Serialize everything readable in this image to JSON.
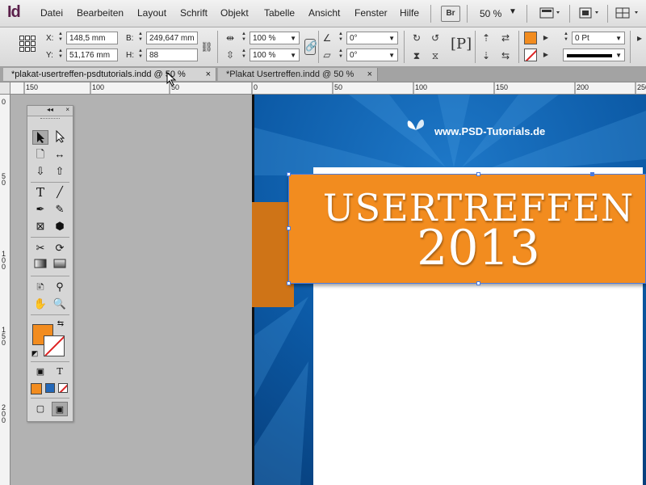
{
  "app": {
    "logo": "Id"
  },
  "menu": [
    "Datei",
    "Bearbeiten",
    "Layout",
    "Schrift",
    "Objekt",
    "Tabelle",
    "Ansicht",
    "Fenster",
    "Hilfe"
  ],
  "menubar": {
    "bridge_label": "Br",
    "zoom": "50 %"
  },
  "control": {
    "x_label": "X:",
    "x_value": "148,5 mm",
    "y_label": "Y:",
    "y_value": "51,176 mm",
    "w_label": "B:",
    "w_value": "249,647 mm",
    "h_label": "H:",
    "h_value": "88",
    "scale_x": "100 %",
    "scale_y": "100 %",
    "rotate": "0°",
    "shear": "0°",
    "stroke_weight": "0 Pt",
    "fill_color": "#f28c1f"
  },
  "tabs": [
    {
      "label": "*plakat-usertreffen-psdtutorials.indd @ 50 %",
      "close": "×"
    },
    {
      "label": "*Plakat Usertreffen.indd @ 50 %",
      "close": "×"
    }
  ],
  "ruler": {
    "h": [
      "150",
      "100",
      "50",
      "0",
      "50",
      "100",
      "150",
      "200",
      "250"
    ],
    "v": [
      "0",
      "5 0",
      "1 0 0",
      "1 5 0",
      "2 0 0"
    ]
  },
  "poster": {
    "brand": "www.PSD-Tutorials.de",
    "title": "USERTREFFEN",
    "year": "2013",
    "background_color": "#0c5aa6",
    "banner_color": "#f28c1f"
  },
  "tools_panel": {
    "collapse": "◂◂",
    "close": "×"
  }
}
